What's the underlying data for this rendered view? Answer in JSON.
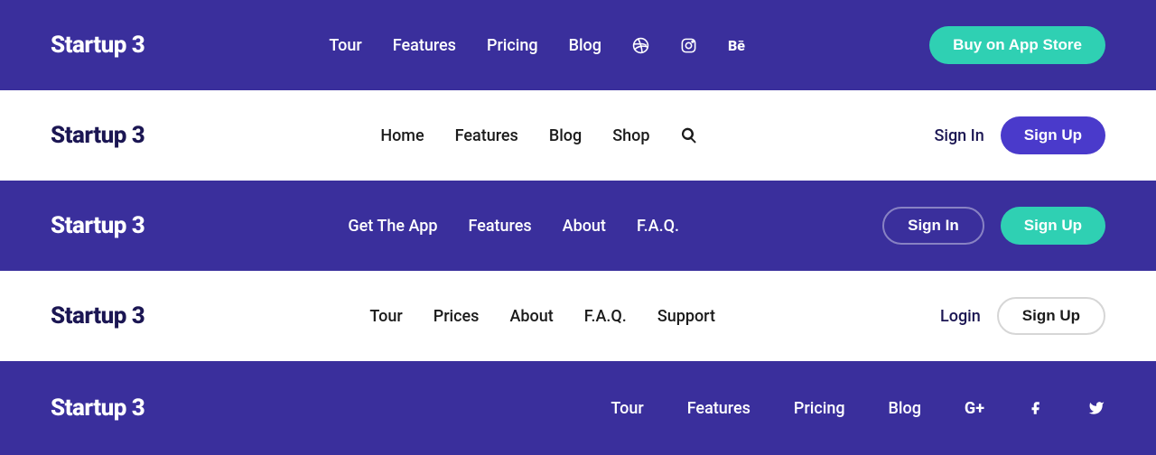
{
  "brand": "Startup 3",
  "row1": {
    "links": [
      "Tour",
      "Features",
      "Pricing",
      "Blog"
    ],
    "cta": "Buy on App Store",
    "icons": [
      "dribbble",
      "instagram",
      "behance"
    ]
  },
  "row2": {
    "links": [
      "Home",
      "Features",
      "Blog",
      "Shop"
    ],
    "signin": "Sign In",
    "signup": "Sign Up",
    "icon": "search"
  },
  "row3": {
    "links": [
      "Get The App",
      "Features",
      "About",
      "F.A.Q."
    ],
    "signin": "Sign In",
    "signup": "Sign Up"
  },
  "row4": {
    "links": [
      "Tour",
      "Prices",
      "About",
      "F.A.Q.",
      "Support"
    ],
    "login": "Login",
    "signup": "Sign Up"
  },
  "row5": {
    "links": [
      "Tour",
      "Features",
      "Pricing",
      "Blog"
    ],
    "icons": [
      "google-plus",
      "facebook",
      "twitter"
    ]
  },
  "colors": {
    "purple_bg": "#3a2f9c",
    "teal": "#2fd0b3",
    "purple_btn": "#4a3acb"
  }
}
